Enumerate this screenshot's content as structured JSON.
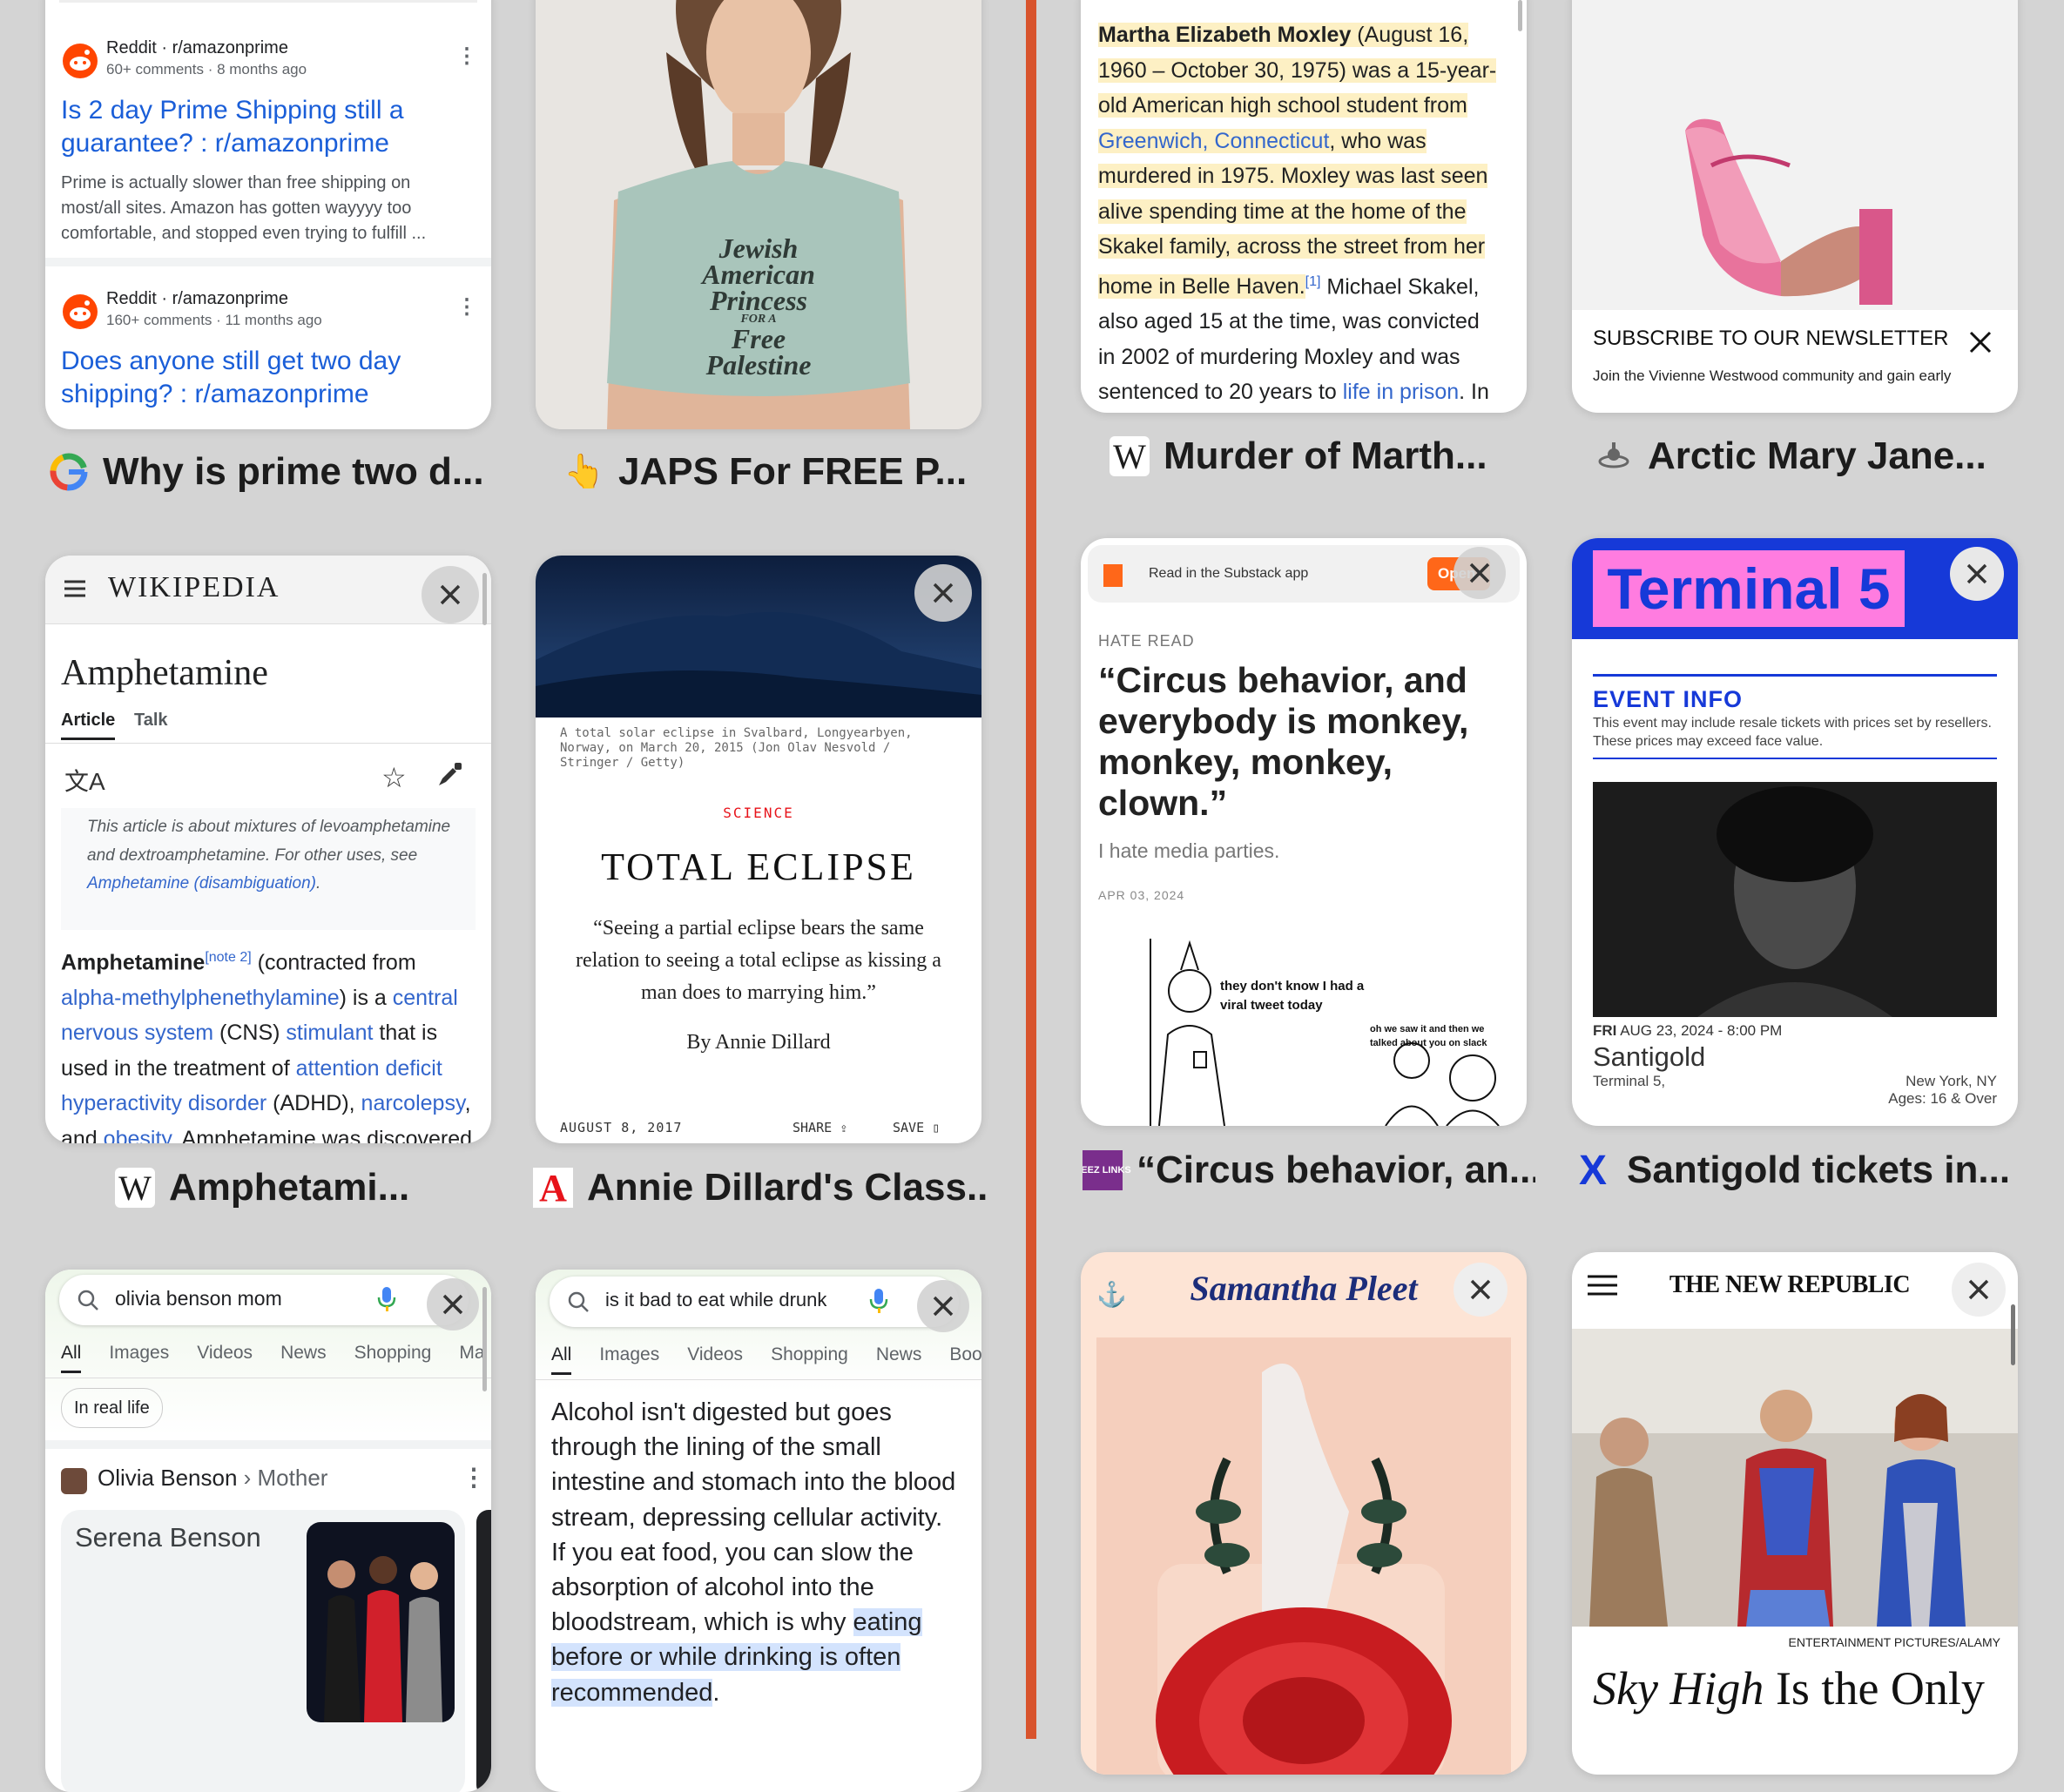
{
  "tabs": {
    "reddit": {
      "title": "Why is prime two d...",
      "r1_source": "Reddit · r/amazonprime",
      "r1_meta": "60+ comments · 8 months ago",
      "r1_title": "Is 2 day Prime Shipping still a guarantee? : r/amazonprime",
      "r1_snippet": "Prime is actually slower than free shipping on most/all sites. Amazon has gotten wayyyy too comfortable, and stopped even trying to fulfill ...",
      "r2_source": "Reddit · r/amazonprime",
      "r2_meta": "160+ comments · 11 months ago",
      "r2_title": "Does anyone still get two day shipping? : r/amazonprime"
    },
    "japs": {
      "title": "JAPS For FREE P...",
      "shirt_text": [
        "Jewish",
        "American",
        "Princess",
        "FOR A",
        "Free",
        "Palestine"
      ]
    },
    "wiki_moxley": {
      "title": "Murder of Marth...",
      "name": "Martha Elizabeth Moxley",
      "t1": " (August 16, 1960 – October 30, 1975) was a 15-year-old American high school student from ",
      "link1": "Greenwich, Connecticut",
      "t2": ", who was murdered in 1975. Moxley was last seen alive spending time at the home of the Skakel family, across the street from her home in Belle Haven.",
      "ref": "[1]",
      "t3": " Michael Skakel, also aged 15 at the time, was convicted in 2002 of murdering Moxley and was sentenced to 20 years to ",
      "link2": "life in prison",
      "t4": ". In"
    },
    "vivienne": {
      "title": "Arctic Mary Jane...",
      "newsletter_title": "SUBSCRIBE TO OUR NEWSLETTER",
      "newsletter_text": "Join the Vivienne Westwood community and gain early"
    },
    "wiki_amphetamine": {
      "title": "Amphetami...",
      "logo": "WIKIPEDIA",
      "heading": "Amphetamine",
      "tab_article": "Article",
      "tab_talk": "Talk",
      "hatnote1": "This article is about mixtures of levoamphetamine and dextroamphetamine. For other uses, see ",
      "hatnote_link": "Amphetamine (disambiguation)",
      "hatnote_end": ".",
      "b_name": "Amphetamine",
      "b_note": "[note 2]",
      "b1": " (contracted from ",
      "b_link1": "alpha-methylphenethylamine",
      "b2": ") is a ",
      "b_link2": "central nervous system",
      "b3": " (CNS) ",
      "b_link3": "stimulant",
      "b4": " that is used in the treatment of ",
      "b_link4": "attention deficit hyperactivity disorder",
      "b5": " (ADHD), ",
      "b_link5": "narcolepsy",
      "b6": ", and ",
      "b_link6": "obesity",
      "b7": ". Amphetamine was discovered"
    },
    "atlantic": {
      "title": "Annie Dillard's Class...",
      "caption": "A total solar eclipse in Svalbard, Longyearbyen, Norway, on March 20, 2015 (Jon Olav Nesvold / Stringer / Getty)",
      "section": "SCIENCE",
      "headline": "TOTAL ECLIPSE",
      "quote": "“Seeing a partial eclipse bears the same relation to seeing a total eclipse as kissing a man does to marrying him.”",
      "byline": "By Annie Dillard",
      "date": "AUGUST 8, 2017",
      "share": "SHARE",
      "save": "SAVE"
    },
    "substack": {
      "title": "“Circus behavior, an...",
      "banner": "Read in the Substack app",
      "open": "Open",
      "kicker": "HATE READ",
      "headline": "“Circus behavior, and everybody is monkey, monkey, monkey, clown.”",
      "subtitle": "I hate media parties.",
      "date": "APR 03, 2024",
      "comic1": "they don't know I had a viral tweet today",
      "comic2": "oh we saw it and then we talked about you on slack",
      "fav_text": "DEEZ LINKS"
    },
    "terminal5": {
      "title": "Santigold tickets in...",
      "logo": "Terminal 5",
      "event_info": "EVENT INFO",
      "resale_note": "This event may include resale tickets with prices set by resellers. These prices may exceed face value.",
      "day": "FRI",
      "datetime": "AUG 23, 2024 - 8:00 PM",
      "artist": "Santigold",
      "venue": "Terminal 5,",
      "city": "New York, NY",
      "ages": "Ages: 16 & Over"
    },
    "google_olivia": {
      "query": "olivia benson mom",
      "tabs": [
        "All",
        "Images",
        "Videos",
        "News",
        "Shopping",
        "Ma"
      ],
      "chip": "In real life",
      "entity": "Olivia Benson",
      "entity_rel": " › Mother",
      "answer": "Serena Benson"
    },
    "google_drunk": {
      "query": "is it bad to eat while drunk",
      "tabs": [
        "All",
        "Images",
        "Videos",
        "Shopping",
        "News",
        "Boo"
      ],
      "answer": "Alcohol isn't digested but goes through the lining of the small intestine and stomach into the blood stream, depressing cellular activity. If you eat food, you can slow the absorption of alcohol into the bloodstream, which is why ",
      "highlight": "eating before or while drinking is often recommended",
      "end": "."
    },
    "samantha": {
      "logo": "Samantha Pleet"
    },
    "tnr": {
      "logo": "THE NEW REPUBLIC",
      "credit": "ENTERTAINMENT PICTURES/ALAMY",
      "headline_italic": "Sky High",
      "headline_rest": " Is the Only"
    }
  },
  "colors": {
    "divider": "#d8532c",
    "wiki_highlight": "#fdf0c4",
    "terminal5_blue": "#1639d8",
    "terminal5_pink": "#ff7ce0",
    "substack_orange": "#ff6719"
  }
}
